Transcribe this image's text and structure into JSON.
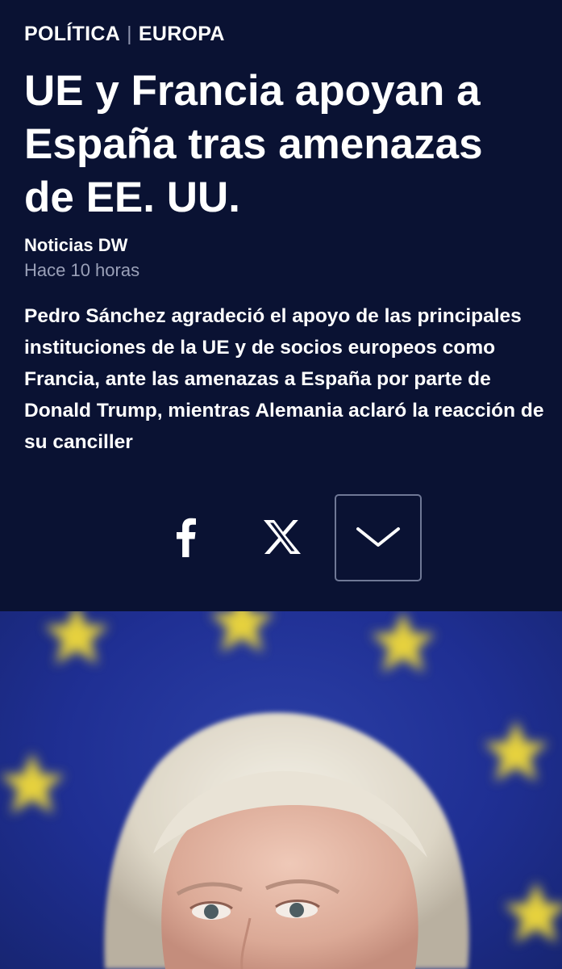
{
  "header": {
    "section": "POLÍTICA",
    "subsection": "EUROPA",
    "headline": "UE y Francia apoyan a España tras amenazas de EE. UU.",
    "source": "Noticias DW",
    "timestamp": "Hace 10 horas",
    "summary": "Pedro Sánchez agradeció el apoyo de las principales instituciones de la UE y de socios europeos como Francia, ante las amenazas a España por parte de Donald Trump, mientras Alemania aclaró la reacción de su canciller"
  },
  "share": {
    "facebook_icon": "facebook-icon",
    "x_icon": "x-icon",
    "more_icon": "chevron-down-icon"
  },
  "colors": {
    "background": "#0a1233",
    "text": "#ffffff",
    "muted": "#9aa0b8",
    "photo_blue": "#2236a0",
    "star_yellow": "#e6d23c"
  }
}
